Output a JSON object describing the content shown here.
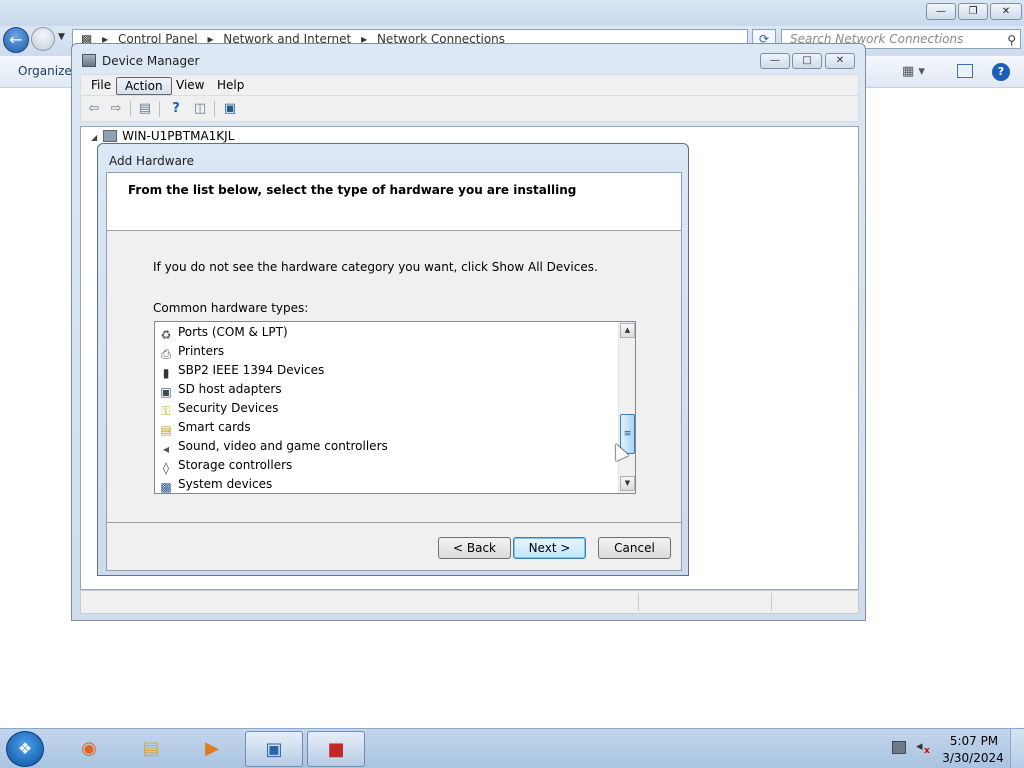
{
  "explorer": {
    "breadcrumb": [
      "Control Panel",
      "Network and Internet",
      "Network Connections"
    ],
    "search_placeholder": "Search Network Connections",
    "organize_label": "Organize"
  },
  "device_manager": {
    "title": "Device Manager",
    "menu": [
      "File",
      "Action",
      "View",
      "Help"
    ],
    "active_menu": "Action",
    "tree_root": "WIN-U1PBTMA1KJL"
  },
  "add_hardware": {
    "title": "Add Hardware",
    "header": "From the list below, select the type of hardware you are installing",
    "instructions": "If you do not see the hardware category you want, click Show All Devices.",
    "list_label": "Common hardware types:",
    "items": [
      {
        "label": "Ports (COM & LPT)",
        "icon": "port-icon"
      },
      {
        "label": "Printers",
        "icon": "printer-icon"
      },
      {
        "label": "SBP2 IEEE 1394 Devices",
        "icon": "ieee1394-icon"
      },
      {
        "label": "SD host adapters",
        "icon": "sd-card-icon"
      },
      {
        "label": "Security Devices",
        "icon": "key-icon"
      },
      {
        "label": "Smart cards",
        "icon": "smart-card-icon"
      },
      {
        "label": "Sound, video and game controllers",
        "icon": "speaker-icon"
      },
      {
        "label": "Storage controllers",
        "icon": "storage-controller-icon"
      },
      {
        "label": "System devices",
        "icon": "computer-icon"
      }
    ],
    "buttons": {
      "back": "< Back",
      "next": "Next >",
      "cancel": "Cancel"
    }
  },
  "taskbar": {
    "apps": [
      "firefox-icon",
      "file-explorer-icon",
      "media-player-icon",
      "control-panel-icon",
      "toolbox-icon"
    ],
    "time": "5:07 PM",
    "date": "3/30/2024"
  },
  "colors": {
    "accent": "#3c7fb1",
    "window_frame": "#cfdded",
    "dialog_background": "#f0f0f0"
  }
}
